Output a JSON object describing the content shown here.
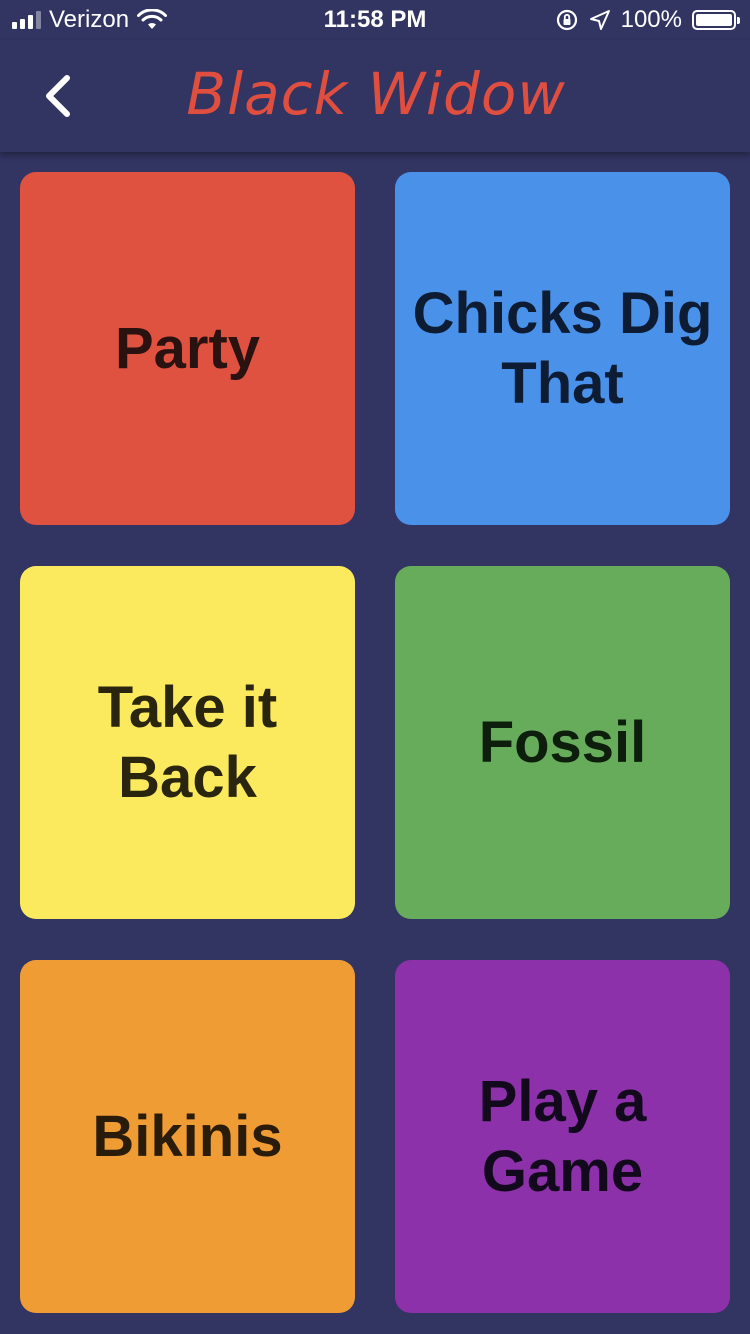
{
  "status_bar": {
    "carrier": "Verizon",
    "time": "11:58 PM",
    "battery_percent": "100%",
    "battery_level": 1.0,
    "signal_bars": 3,
    "signal_bars_total": 4
  },
  "nav": {
    "back_icon": "chevron-left-icon",
    "title": "Black Widow",
    "title_color": "#e04e3f"
  },
  "tiles": [
    {
      "label": "Party",
      "color": "#e05240",
      "text_color": "#2a1210"
    },
    {
      "label": "Chicks Dig That",
      "color": "#4a91ea",
      "text_color": "#0d1c33"
    },
    {
      "label": "Take it Back",
      "color": "#fcea5e",
      "text_color": "#2a250f"
    },
    {
      "label": "Fossil",
      "color": "#67ac5b",
      "text_color": "#0d1f0c"
    },
    {
      "label": "Bikinis",
      "color": "#f09c35",
      "text_color": "#2a1c0a"
    },
    {
      "label": "Play a Game",
      "color": "#8c31a9",
      "text_color": "#120a1c"
    }
  ],
  "colors": {
    "background": "#323462"
  }
}
